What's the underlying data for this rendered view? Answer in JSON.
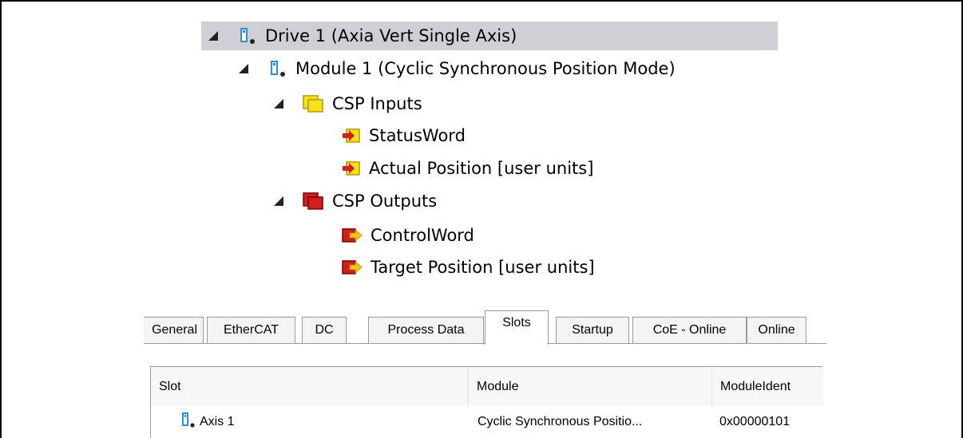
{
  "tree": {
    "items": [
      {
        "label": "Drive 1 (Axia Vert Single Axis)",
        "icon": "drive-icon",
        "selected": true
      },
      {
        "label": "Module 1 (Cyclic Synchronous Position Mode)",
        "icon": "module-icon"
      },
      {
        "label": "CSP Inputs",
        "icon": "input-group-icon"
      },
      {
        "label": "StatusWord",
        "icon": "input-variable-icon"
      },
      {
        "label": "Actual Position [user units]",
        "icon": "input-variable-icon"
      },
      {
        "label": "CSP Outputs",
        "icon": "output-group-icon"
      },
      {
        "label": "ControlWord",
        "icon": "output-variable-icon"
      },
      {
        "label": "Target Position [user units]",
        "icon": "output-variable-icon"
      }
    ]
  },
  "tabs": {
    "items": [
      "General",
      "EtherCAT",
      "DC",
      "Process Data",
      "Slots",
      "Startup",
      "CoE - Online",
      "Online"
    ],
    "active": "Slots"
  },
  "grid": {
    "headers": {
      "slot": "Slot",
      "module": "Module",
      "module_ident": "ModuleIdent"
    },
    "rows": [
      {
        "slot": "Axis 1",
        "module": "Cyclic Synchronous Positio...",
        "module_ident": "0x00000101",
        "icon": "axis-icon"
      }
    ]
  },
  "colors": {
    "selection": "#cfcfd6",
    "input_yellow": "#f5e11a",
    "output_red": "#d11f1f",
    "drive_blue": "#2b8fd6"
  }
}
